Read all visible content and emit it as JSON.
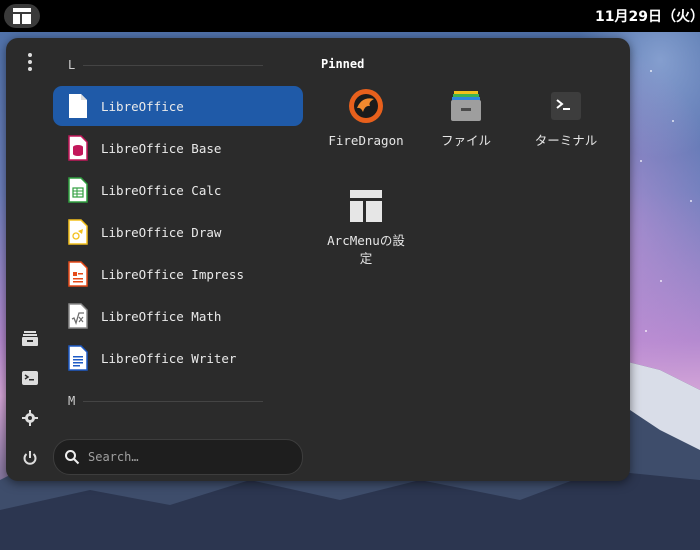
{
  "topbar": {
    "clock": "11月29日（火）"
  },
  "menu": {
    "sections": {
      "l": "L",
      "m": "M"
    },
    "apps": [
      {
        "label": "LibreOffice",
        "icon": "libreoffice-icon",
        "color": "#ffffff"
      },
      {
        "label": "LibreOffice Base",
        "icon": "libreoffice-base-icon",
        "color": "#c2185b"
      },
      {
        "label": "LibreOffice Calc",
        "icon": "libreoffice-calc-icon",
        "color": "#2e9e3e"
      },
      {
        "label": "LibreOffice Draw",
        "icon": "libreoffice-draw-icon",
        "color": "#f3c01c"
      },
      {
        "label": "LibreOffice Impress",
        "icon": "libreoffice-impress-icon",
        "color": "#e64a19"
      },
      {
        "label": "LibreOffice Math",
        "icon": "libreoffice-math-icon",
        "color": "#8a8a8a"
      },
      {
        "label": "LibreOffice Writer",
        "icon": "libreoffice-writer-icon",
        "color": "#1e5bc6"
      }
    ],
    "search": {
      "placeholder": "Search…"
    },
    "pinned": {
      "title": "Pinned",
      "items": [
        {
          "label": "FireDragon",
          "icon": "firedragon-icon"
        },
        {
          "label": "ファイル",
          "icon": "files-icon"
        },
        {
          "label": "ターミナル",
          "icon": "terminal-icon"
        },
        {
          "label": "ArcMenuの設定",
          "icon": "arcmenu-settings-icon"
        }
      ]
    }
  },
  "colors": {
    "accent": "#1f5aa8",
    "panel": "#2b2b2b",
    "topbar": "#000000"
  }
}
